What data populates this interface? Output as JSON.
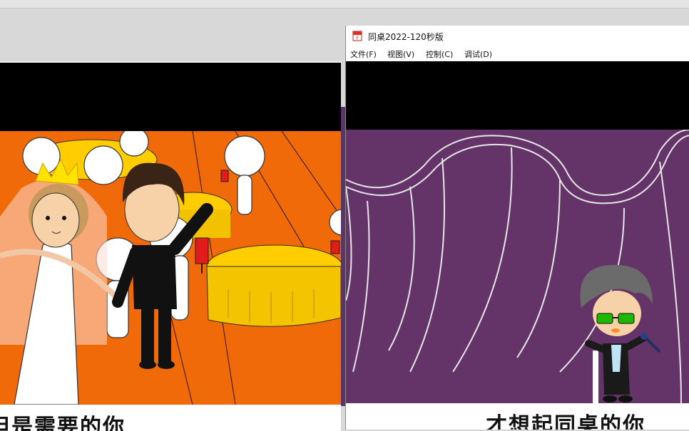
{
  "player_window": {
    "title": "同桌2022-120秒版",
    "menu": [
      "文件(F)",
      "视图(V)",
      "控制(C)",
      "调试(D)"
    ],
    "icon": "flash-player-icon"
  },
  "left_video": {
    "caption": "但是需要的你"
  },
  "right_video": {
    "caption": "才想起同桌的你"
  },
  "colors": {
    "left_floor": "#f06a0a",
    "table_yellow": "#ffcd00",
    "stage_purple": "#643468",
    "frame_black": "#000000"
  }
}
